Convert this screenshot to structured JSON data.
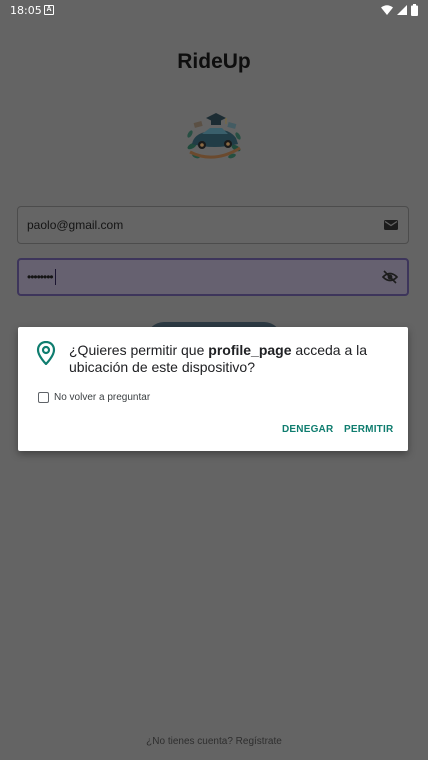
{
  "status_bar": {
    "time": "18:05",
    "notification_letter": "A",
    "icons": [
      "wifi-icon",
      "signal-icon",
      "battery-icon"
    ]
  },
  "app": {
    "title": "RideUp",
    "email_value": "paolo@gmail.com",
    "password_masked": "••••••••",
    "register_text": "¿No tienes cuenta? Regístrate"
  },
  "dialog": {
    "message_prefix": "¿Quieres permitir que ",
    "app_name": "profile_page",
    "message_suffix": " acceda a la ubicación de este dispositivo?",
    "checkbox_label": "No volver a preguntar",
    "checkbox_checked": false,
    "deny_label": "DENEGAR",
    "allow_label": "PERMITIR"
  },
  "colors": {
    "scrim_background": "#646464",
    "dialog_accent": "#0f7d6f",
    "dialog_background": "#ffffff"
  }
}
